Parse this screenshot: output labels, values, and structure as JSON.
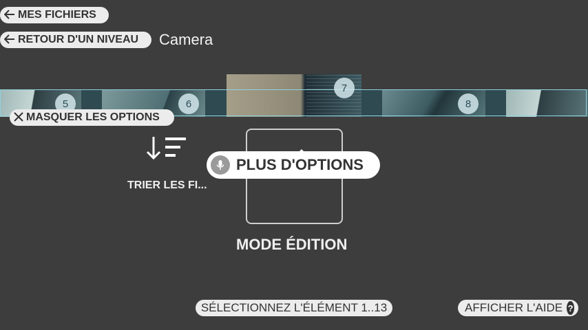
{
  "header": {
    "my_files_label": "MES FICHIERS",
    "up_level_label": "RETOUR D'UN NIVEAU",
    "folder_title": "Camera"
  },
  "filmstrip": {
    "badges": [
      "5",
      "6",
      "7",
      "8"
    ],
    "selected_index": "7"
  },
  "options": {
    "hide_options_label": "MASQUER LES OPTIONS",
    "sort_label": "TRIER LES FI...",
    "edit_mode_label": "MODE ÉDITION",
    "more_options_label": "PLUS D'OPTIONS"
  },
  "footer": {
    "select_label": "SÉLECTIONNEZ L'ÉLÉMENT 1..13",
    "help_label": "AFFICHER L'AIDE",
    "help_icon_glyph": "?"
  },
  "colors": {
    "background": "#3d3d3d",
    "pill_bg": "#ececec",
    "strip_border": "#8fd2e0"
  },
  "icons": [
    "arrow-left-icon",
    "close-icon",
    "sort-icon",
    "edit-icon",
    "microphone-icon",
    "help-icon"
  ]
}
